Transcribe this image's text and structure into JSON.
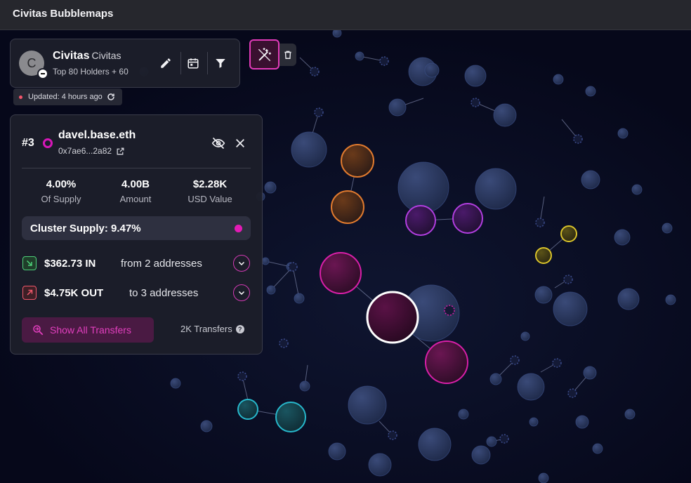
{
  "window": {
    "title": "Civitas Bubblemaps"
  },
  "token": {
    "avatar_letter": "C",
    "name": "Civitas",
    "symbol": "Civitas",
    "holders": "Top 80 Holders + 60",
    "updated": "Updated: 4 hours ago",
    "icons": [
      "pencil-icon",
      "calendar-icon",
      "filter-icon",
      "refresh-icon"
    ]
  },
  "toolbar": {
    "icons": [
      "magic-wand-icon",
      "trash-icon"
    ],
    "accent": "#e23ab9"
  },
  "wallet": {
    "rank": "#3",
    "name": "davel.base.eth",
    "short_address": "0x7ae6...2a82",
    "stats": [
      {
        "value": "4.00%",
        "label": "Of Supply"
      },
      {
        "value": "4.00B",
        "label": "Amount"
      },
      {
        "value": "$2.28K",
        "label": "USD Value"
      }
    ],
    "cluster_supply": "Cluster Supply: 9.47%",
    "inflow": {
      "amount": "$362.73 IN",
      "detail": "from 2 addresses"
    },
    "outflow": {
      "amount": "$4.75K OUT",
      "detail": "to 3 addresses"
    },
    "show_all_label": "Show All Transfers",
    "transfers_count": "2K Transfers",
    "colors": {
      "highlight": "#d617b8",
      "in": "#4ed07a",
      "out": "#f0586b"
    }
  },
  "bubble_colors": {
    "orange": "#e07a2e",
    "purple": "#b23ee0",
    "magenta": "#d81fa8",
    "yellow": "#d9c32a",
    "cyan": "#27b8cc",
    "selected": "#ffffff",
    "neutral": "#2a3a63"
  }
}
